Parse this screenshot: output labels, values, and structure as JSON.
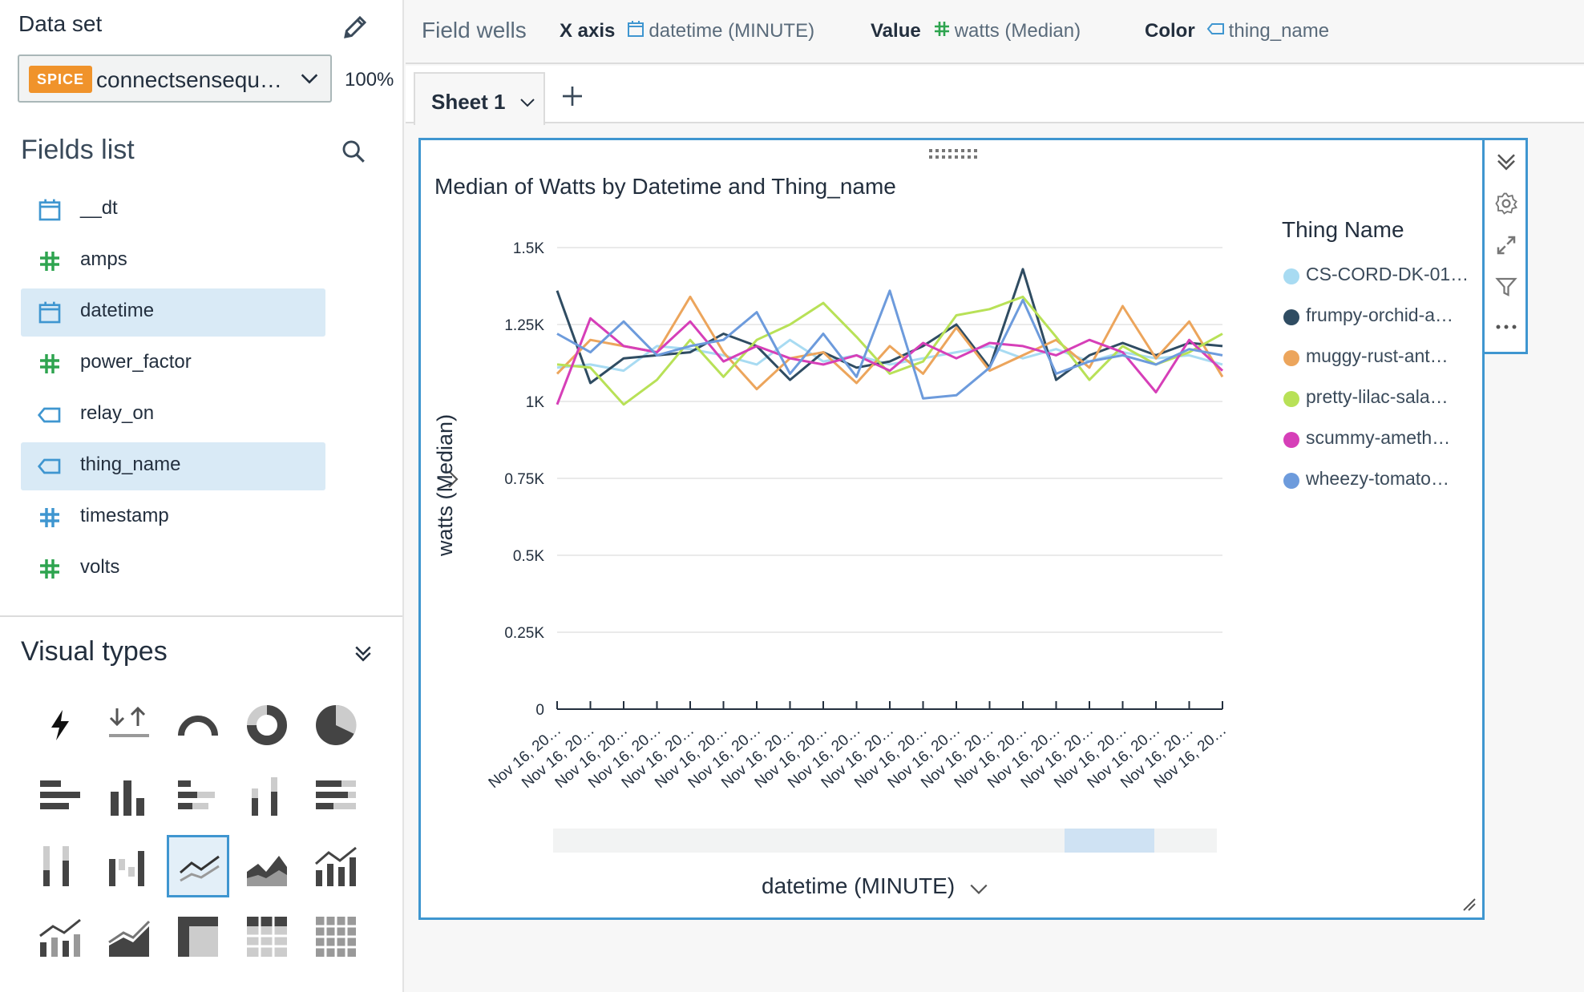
{
  "left_panel": {
    "dataset_label": "Data set",
    "spice_badge": "SPICE",
    "dataset_name": "connectsensequ…",
    "spice_usage": "100%",
    "fields_title": "Fields list",
    "fields": [
      {
        "name": "__dt",
        "icon": "calendar-icon",
        "selected": false
      },
      {
        "name": "amps",
        "icon": "hash-icon",
        "selected": false
      },
      {
        "name": "datetime",
        "icon": "calendar-icon",
        "selected": true
      },
      {
        "name": "power_factor",
        "icon": "hash-icon",
        "selected": false
      },
      {
        "name": "relay_on",
        "icon": "tag-icon",
        "selected": false
      },
      {
        "name": "thing_name",
        "icon": "tag-icon",
        "selected": true
      },
      {
        "name": "timestamp",
        "icon": "hash-blue-icon",
        "selected": false
      },
      {
        "name": "volts",
        "icon": "hash-icon",
        "selected": false
      }
    ],
    "visual_types_title": "Visual types"
  },
  "field_wells": {
    "title": "Field wells",
    "x_axis_label": "X axis",
    "x_axis_value": "datetime (MINUTE)",
    "value_label": "Value",
    "value_value": "watts (Median)",
    "color_label": "Color",
    "color_value": "thing_name"
  },
  "sheet": {
    "tab_label": "Sheet 1"
  },
  "visual": {
    "title": "Median of Watts by Datetime and Thing_name",
    "legend_title": "Thing Name",
    "y_axis_title": "watts (Median)",
    "x_axis_title": "datetime (MINUTE)"
  },
  "colors": {
    "accent": "#3f96d0",
    "spice": "#f0932b",
    "measure_green": "#2ea44f",
    "dimension_blue": "#3f96d0"
  },
  "chart_data": {
    "type": "line",
    "x_tick_label": "Nov 16, 20…",
    "x": [
      "Nov 16, 20…",
      "Nov 16, 20…",
      "Nov 16, 20…",
      "Nov 16, 20…",
      "Nov 16, 20…",
      "Nov 16, 20…",
      "Nov 16, 20…",
      "Nov 16, 20…",
      "Nov 16, 20…",
      "Nov 16, 20…",
      "Nov 16, 20…",
      "Nov 16, 20…",
      "Nov 16, 20…",
      "Nov 16, 20…",
      "Nov 16, 20…",
      "Nov 16, 20…",
      "Nov 16, 20…",
      "Nov 16, 20…",
      "Nov 16, 20…",
      "Nov 16, 20…",
      "Nov 16, 20…"
    ],
    "y_ticks": [
      "0",
      "0.25K",
      "0.5K",
      "0.75K",
      "1K",
      "1.25K",
      "1.5K"
    ],
    "ylim": [
      0,
      1500
    ],
    "grid": true,
    "legend_position": "right",
    "series": [
      {
        "name": "CS-CORD-DK-01…",
        "color": "#a8dbf2",
        "values": [
          1110,
          1120,
          1100,
          1180,
          1170,
          1150,
          1120,
          1200,
          1130,
          1150,
          1120,
          1140,
          1160,
          1180,
          1140,
          1170,
          1130,
          1160,
          1140,
          1150,
          1120
        ]
      },
      {
        "name": "frumpy-orchid-a…",
        "color": "#2f4c62",
        "values": [
          1360,
          1060,
          1140,
          1150,
          1160,
          1220,
          1180,
          1070,
          1160,
          1110,
          1130,
          1180,
          1250,
          1110,
          1430,
          1070,
          1150,
          1190,
          1150,
          1190,
          1180
        ]
      },
      {
        "name": "muggy-rust-ant…",
        "color": "#eca55c",
        "values": [
          1090,
          1200,
          1180,
          1160,
          1340,
          1160,
          1040,
          1140,
          1160,
          1060,
          1180,
          1090,
          1240,
          1100,
          1150,
          1200,
          1110,
          1310,
          1140,
          1260,
          1080
        ]
      },
      {
        "name": "pretty-lilac-sala…",
        "color": "#b8e157",
        "values": [
          1120,
          1110,
          990,
          1070,
          1200,
          1080,
          1200,
          1250,
          1320,
          1210,
          1090,
          1130,
          1280,
          1300,
          1340,
          1210,
          1070,
          1180,
          1120,
          1160,
          1220
        ]
      },
      {
        "name": "scummy-ameth…",
        "color": "#d63fb8",
        "values": [
          990,
          1270,
          1180,
          1160,
          1260,
          1130,
          1180,
          1140,
          1120,
          1150,
          1100,
          1190,
          1140,
          1190,
          1180,
          1150,
          1200,
          1160,
          1030,
          1200,
          1100
        ]
      },
      {
        "name": "wheezy-tomato…",
        "color": "#6d9bdc",
        "values": [
          1220,
          1160,
          1260,
          1150,
          1180,
          1200,
          1290,
          1090,
          1220,
          1080,
          1360,
          1010,
          1020,
          1110,
          1330,
          1090,
          1130,
          1150,
          1120,
          1170,
          1150
        ]
      }
    ]
  }
}
